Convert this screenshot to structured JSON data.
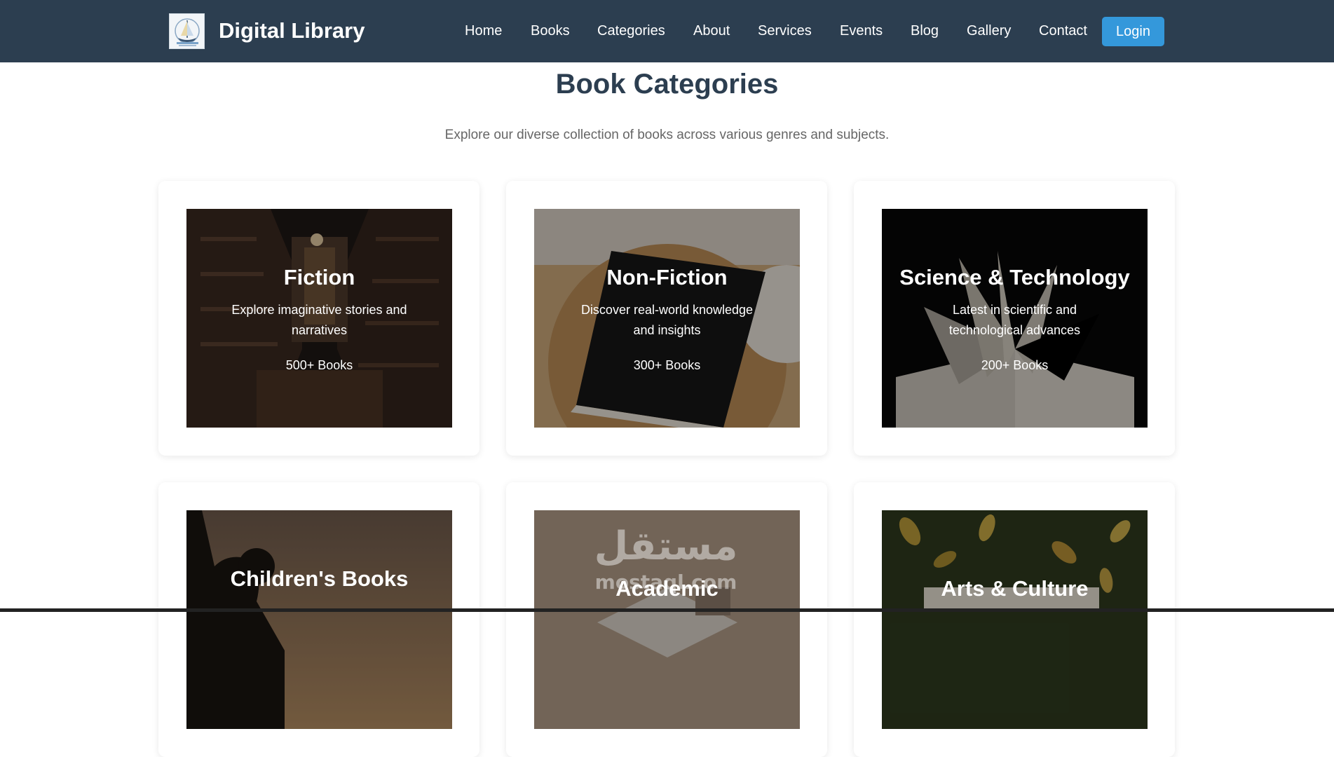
{
  "header": {
    "brand_name": "Digital Library",
    "nav": [
      "Home",
      "Books",
      "Categories",
      "About",
      "Services",
      "Events",
      "Blog",
      "Gallery",
      "Contact"
    ],
    "login_label": "Login"
  },
  "main": {
    "title": "Book Categories",
    "subtitle": "Explore our diverse collection of books across various genres and subjects."
  },
  "categories": [
    {
      "title": "Fiction",
      "description": "Explore imaginative stories and narratives",
      "count": "500+ Books"
    },
    {
      "title": "Non-Fiction",
      "description": "Discover real-world knowledge and insights",
      "count": "300+ Books"
    },
    {
      "title": "Science & Technology",
      "description": "Latest in scientific and technological advances",
      "count": "200+ Books"
    },
    {
      "title": "Children's Books"
    },
    {
      "title": "Academic"
    },
    {
      "title": "Arts & Culture"
    }
  ],
  "watermark": {
    "arabic": "مستقل",
    "latin": "mostaql.com"
  },
  "colors": {
    "header_bg": "#2c3e50",
    "accent": "#3498db",
    "title": "#2c3e50",
    "subtitle": "#666666"
  },
  "icons": [
    "library-logo-icon"
  ]
}
